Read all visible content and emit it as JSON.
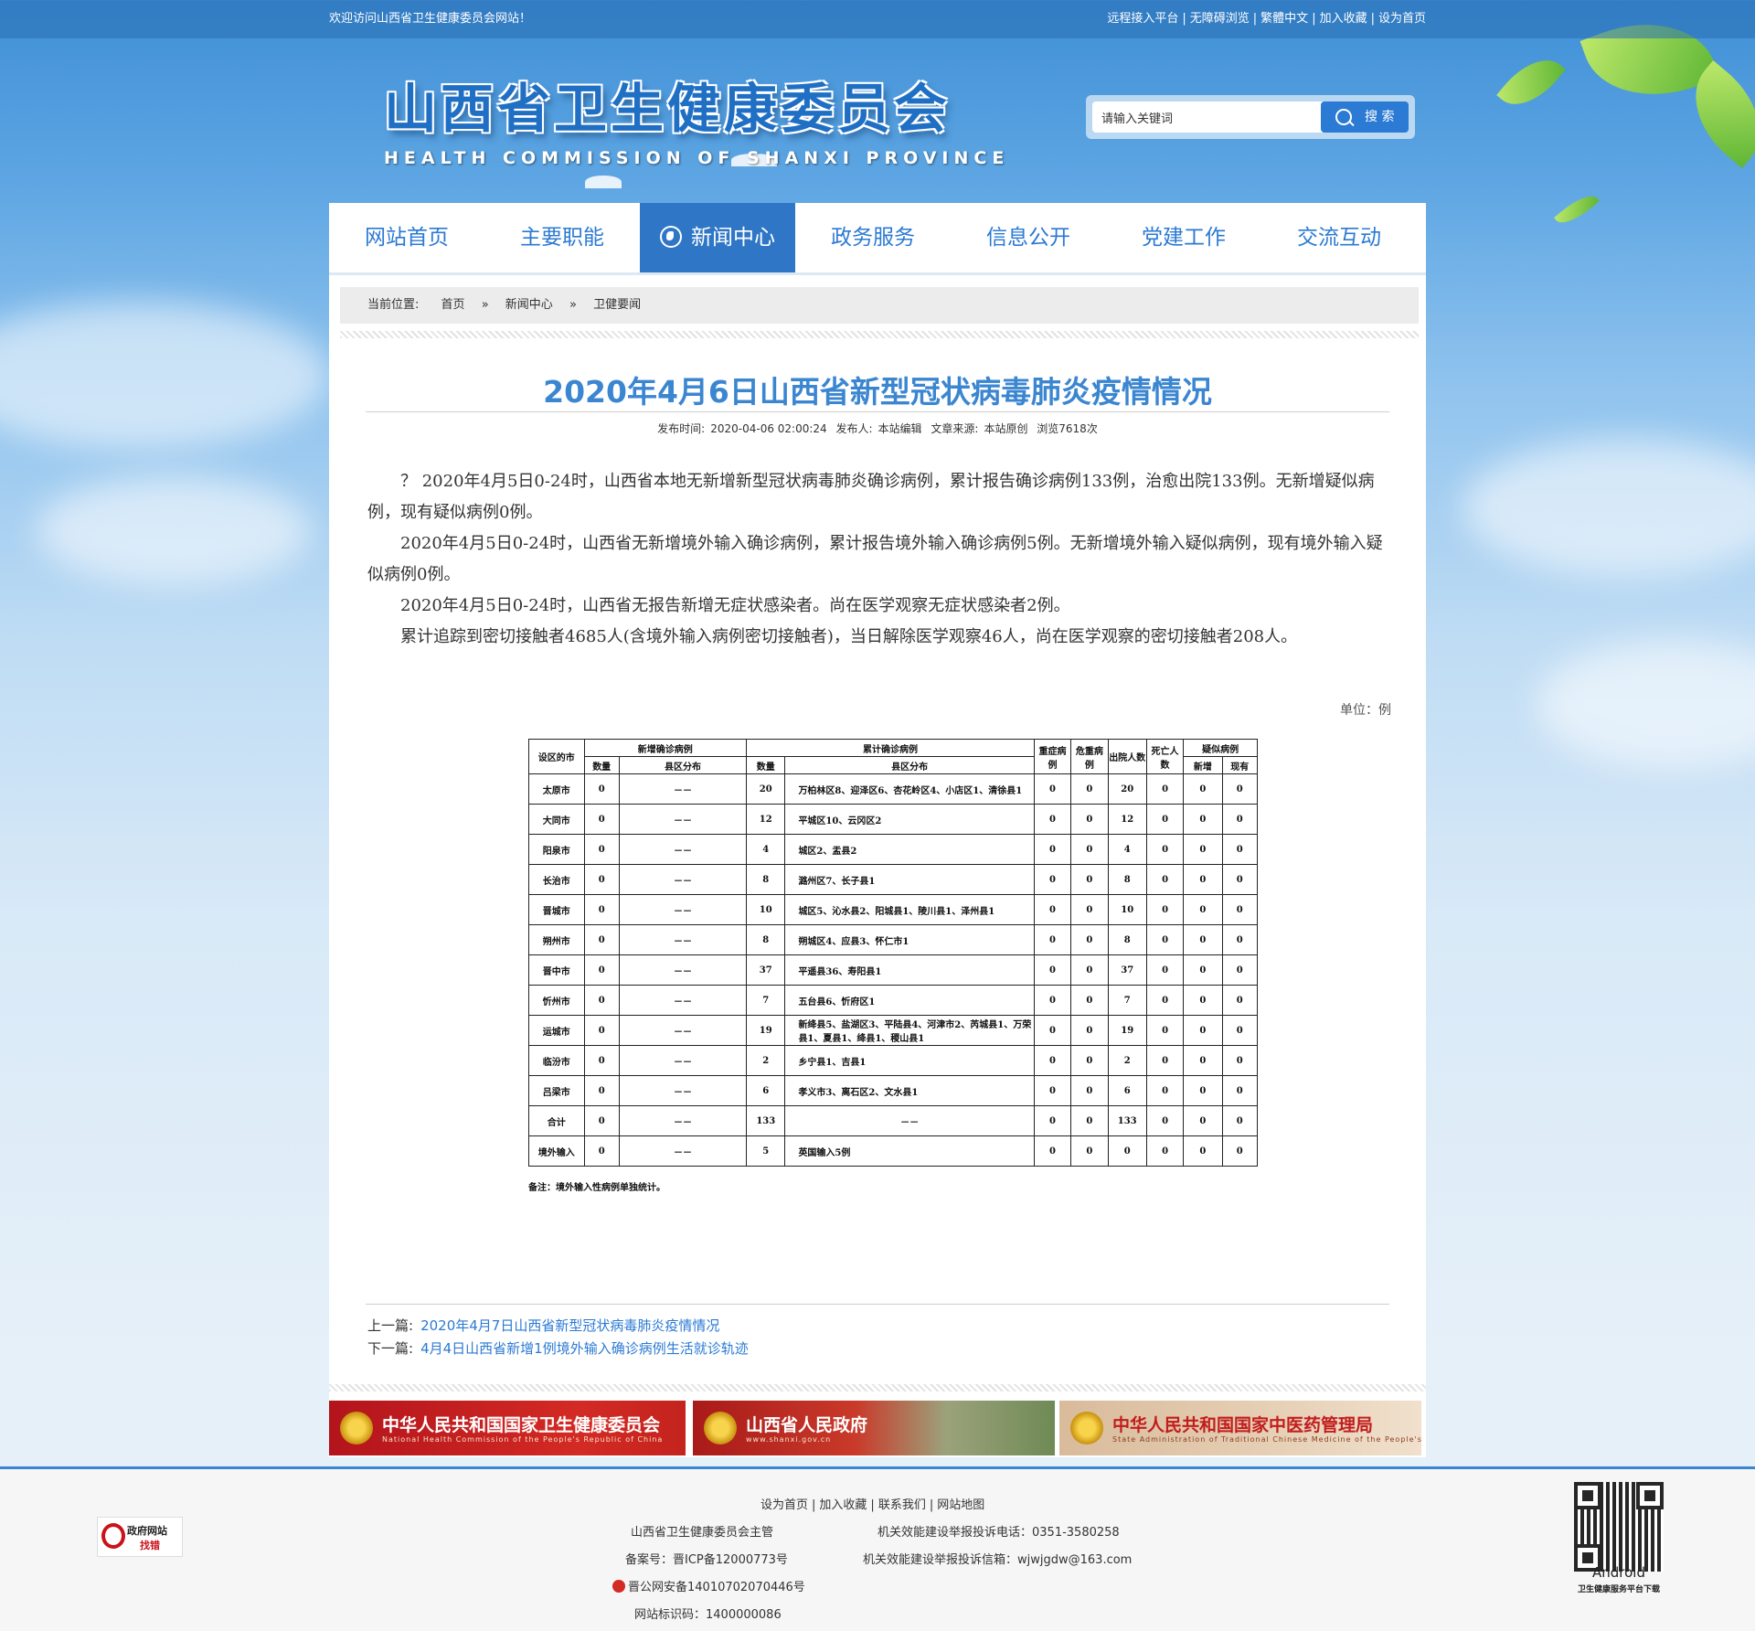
{
  "topbar": {
    "welcome": "欢迎访问山西省卫生健康委员会网站！",
    "links": [
      "远程接入平台",
      "无障碍浏览",
      "繁體中文",
      "加入收藏",
      "设为首页"
    ]
  },
  "header": {
    "logo_cn": "山西省卫生健康委员会",
    "logo_en": "HEALTH COMMISSION OF SHANXI PROVINCE",
    "search_placeholder": "请输入关键词",
    "search_button": "搜 索"
  },
  "nav": {
    "items": [
      "网站首页",
      "主要职能",
      "新闻中心",
      "政务服务",
      "信息公开",
      "党建工作",
      "交流互动"
    ],
    "active": "新闻中心"
  },
  "breadcrumb": {
    "label": "当前位置:",
    "items": [
      "首页",
      "新闻中心",
      "卫健要闻"
    ],
    "separator": "»"
  },
  "article": {
    "title": "2020年4月6日山西省新型冠状病毒肺炎疫情情况",
    "meta": {
      "publish_label": "发布时间:",
      "publish_time": "2020-04-06 02:00:24",
      "author_label": "发布人:",
      "author": "本站编辑",
      "source_label": "文章来源:",
      "source": "本站原创",
      "views": "浏览7618次"
    },
    "paragraphs": [
      "？ 2020年4月5日0-24时，山西省本地无新增新型冠状病毒肺炎确诊病例，累计报告确诊病例133例，治愈出院133例。无新增疑似病例，现有疑似病例0例。",
      "2020年4月5日0-24时，山西省无新增境外输入确诊病例，累计报告境外输入确诊病例5例。无新增境外输入疑似病例，现有境外输入疑似病例0例。",
      "2020年4月5日0-24时，山西省无报告新增无症状感染者。尚在医学观察无症状感染者2例。",
      "累计追踪到密切接触者4685人(含境外输入病例密切接触者)，当日解除医学观察46人，尚在医学观察的密切接触者208人。"
    ],
    "unit": "单位：例"
  },
  "table": {
    "headers": {
      "city": "设区的市",
      "new_confirmed": "新增确诊病例",
      "total_confirmed": "累计确诊病例",
      "count": "数量",
      "district": "县区分布",
      "severe": "重症病例",
      "critical": "危重病例",
      "discharged": "出院人数",
      "deaths": "死亡人数",
      "suspected": "疑似病例",
      "new": "新增",
      "current": "现有"
    },
    "rows": [
      {
        "city": "太原市",
        "new_n": "0",
        "new_d": "－－",
        "tot_n": "20",
        "tot_d": "万柏林区8、迎泽区6、杏花岭区4、小店区1、清徐县1",
        "severe": "0",
        "critical": "0",
        "disch": "20",
        "death": "0",
        "s_new": "0",
        "s_cur": "0"
      },
      {
        "city": "大同市",
        "new_n": "0",
        "new_d": "－－",
        "tot_n": "12",
        "tot_d": "平城区10、云冈区2",
        "severe": "0",
        "critical": "0",
        "disch": "12",
        "death": "0",
        "s_new": "0",
        "s_cur": "0"
      },
      {
        "city": "阳泉市",
        "new_n": "0",
        "new_d": "－－",
        "tot_n": "4",
        "tot_d": "城区2、盂县2",
        "severe": "0",
        "critical": "0",
        "disch": "4",
        "death": "0",
        "s_new": "0",
        "s_cur": "0"
      },
      {
        "city": "长治市",
        "new_n": "0",
        "new_d": "－－",
        "tot_n": "8",
        "tot_d": "潞州区7、长子县1",
        "severe": "0",
        "critical": "0",
        "disch": "8",
        "death": "0",
        "s_new": "0",
        "s_cur": "0"
      },
      {
        "city": "晋城市",
        "new_n": "0",
        "new_d": "－－",
        "tot_n": "10",
        "tot_d": "城区5、沁水县2、阳城县1、陵川县1、泽州县1",
        "severe": "0",
        "critical": "0",
        "disch": "10",
        "death": "0",
        "s_new": "0",
        "s_cur": "0"
      },
      {
        "city": "朔州市",
        "new_n": "0",
        "new_d": "－－",
        "tot_n": "8",
        "tot_d": "朔城区4、应县3、怀仁市1",
        "severe": "0",
        "critical": "0",
        "disch": "8",
        "death": "0",
        "s_new": "0",
        "s_cur": "0"
      },
      {
        "city": "晋中市",
        "new_n": "0",
        "new_d": "－－",
        "tot_n": "37",
        "tot_d": "平遥县36、寿阳县1",
        "severe": "0",
        "critical": "0",
        "disch": "37",
        "death": "0",
        "s_new": "0",
        "s_cur": "0"
      },
      {
        "city": "忻州市",
        "new_n": "0",
        "new_d": "－－",
        "tot_n": "7",
        "tot_d": "五台县6、忻府区1",
        "severe": "0",
        "critical": "0",
        "disch": "7",
        "death": "0",
        "s_new": "0",
        "s_cur": "0"
      },
      {
        "city": "运城市",
        "new_n": "0",
        "new_d": "－－",
        "tot_n": "19",
        "tot_d": "新绛县5、盐湖区3、平陆县4、河津市2、芮城县1、万荣县1、夏县1、绛县1、稷山县1",
        "severe": "0",
        "critical": "0",
        "disch": "19",
        "death": "0",
        "s_new": "0",
        "s_cur": "0"
      },
      {
        "city": "临汾市",
        "new_n": "0",
        "new_d": "－－",
        "tot_n": "2",
        "tot_d": "乡宁县1、吉县1",
        "severe": "0",
        "critical": "0",
        "disch": "2",
        "death": "0",
        "s_new": "0",
        "s_cur": "0"
      },
      {
        "city": "吕梁市",
        "new_n": "0",
        "new_d": "－－",
        "tot_n": "6",
        "tot_d": "孝义市3、离石区2、文水县1",
        "severe": "0",
        "critical": "0",
        "disch": "6",
        "death": "0",
        "s_new": "0",
        "s_cur": "0"
      },
      {
        "city": "合计",
        "new_n": "0",
        "new_d": "－－",
        "tot_n": "133",
        "tot_d": "－－",
        "severe": "0",
        "critical": "0",
        "disch": "133",
        "death": "0",
        "s_new": "0",
        "s_cur": "0"
      },
      {
        "city": "境外输入",
        "new_n": "0",
        "new_d": "－－",
        "tot_n": "5",
        "tot_d": "英国输入5例",
        "severe": "0",
        "critical": "0",
        "disch": "0",
        "death": "0",
        "s_new": "0",
        "s_cur": "0"
      }
    ],
    "note": "备注：境外输入性病例单独统计。"
  },
  "prevnext": {
    "prev_label": "上一篇:",
    "prev_title": "2020年4月7日山西省新型冠状病毒肺炎疫情情况",
    "next_label": "下一篇:",
    "next_title": "4月4日山西省新增1例境外输入确诊病例生活就诊轨迹"
  },
  "banners": [
    {
      "title": "中华人民共和国国家卫生健康委员会",
      "subtitle": "National Health Commission of the People's Republic of China"
    },
    {
      "title": "山西省人民政府",
      "subtitle": "www.shanxi.gov.cn"
    },
    {
      "title": "中华人民共和国国家中医药管理局",
      "subtitle": "State Administration of Traditional Chinese Medicine of the People's Republic of China"
    }
  ],
  "footer": {
    "links": [
      "设为首页",
      "加入收藏",
      "联系我们",
      "网站地图"
    ],
    "sponsor": "山西省卫生健康委员会主管",
    "icp": "备案号：晋ICP备12000773号",
    "police": "晋公网安备14010702070446号",
    "site_id": "网站标识码：1400000086",
    "phone": "机关效能建设举报投诉电话：0351-3580258",
    "email": "机关效能建设举报投诉信箱：wjwjgdw@163.com",
    "gov_badge_1": "政府网站",
    "gov_badge_2": "找错",
    "qr_label": "Android",
    "qr_caption": "卫生健康服务平台下载"
  }
}
